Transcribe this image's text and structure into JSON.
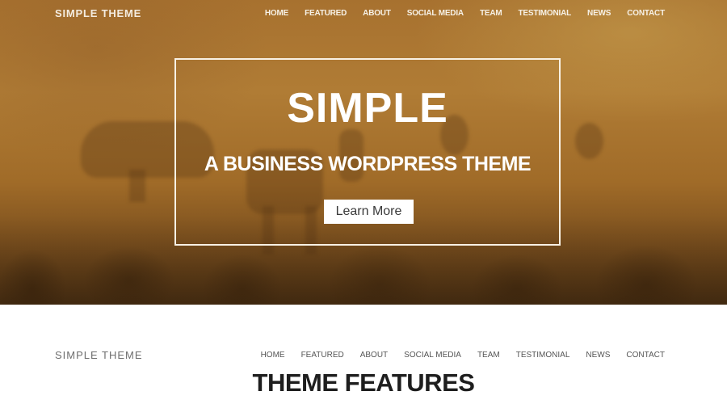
{
  "site": {
    "brand": "SIMPLE THEME"
  },
  "nav": {
    "items": [
      {
        "label": "HOME"
      },
      {
        "label": "FEATURED"
      },
      {
        "label": "ABOUT"
      },
      {
        "label": "SOCIAL MEDIA"
      },
      {
        "label": "TEAM"
      },
      {
        "label": "TESTIMONIAL"
      },
      {
        "label": "NEWS"
      },
      {
        "label": "CONTACT"
      }
    ]
  },
  "hero": {
    "title": "SIMPLE",
    "subtitle": "A BUSINESS WORDPRESS THEME",
    "button_label": "Learn More",
    "overlay_color": "#a7712f"
  },
  "features": {
    "title": "THEME FEATURES"
  }
}
